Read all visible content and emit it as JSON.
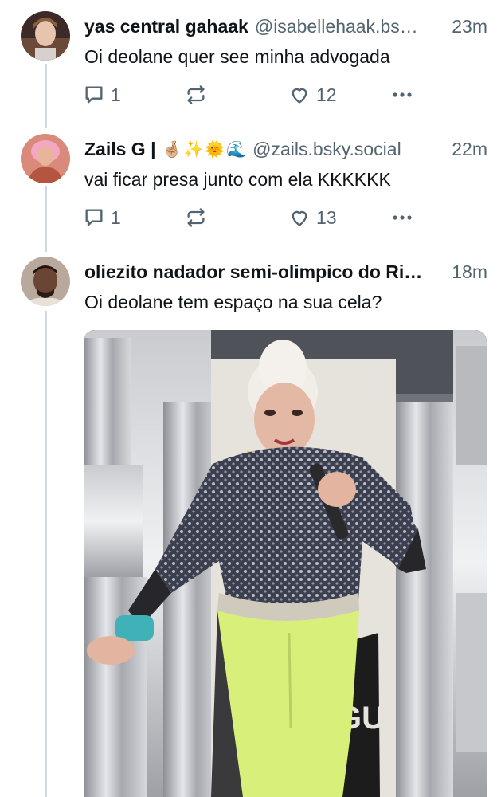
{
  "posts": [
    {
      "author_name": "yas central gahaak",
      "handle": "@isabellehaak.bs…",
      "time": "23m",
      "text": "Oi deolane quer see minha advogada",
      "replies": "1",
      "likes": "12"
    },
    {
      "author_name": "Zails G |",
      "name_emojis": [
        "🤞🏼",
        "✨",
        "🌞",
        "🌊"
      ],
      "handle": "@zails.bsky.social",
      "time": "22m",
      "text": "vai ficar presa junto com ela KKKKKK",
      "replies": "1",
      "likes": "13"
    },
    {
      "author_name": "oliezito nadador semi-olimpico do Ri…",
      "handle": "",
      "time": "18m",
      "text": "Oi deolane tem espaço na sua cela?"
    }
  ],
  "icons": [
    "reply-icon",
    "repost-icon",
    "like-icon",
    "more-icon"
  ],
  "colors": {
    "text": "#0f1419",
    "secondary": "#536471",
    "thread_line": "#cfd9de"
  }
}
